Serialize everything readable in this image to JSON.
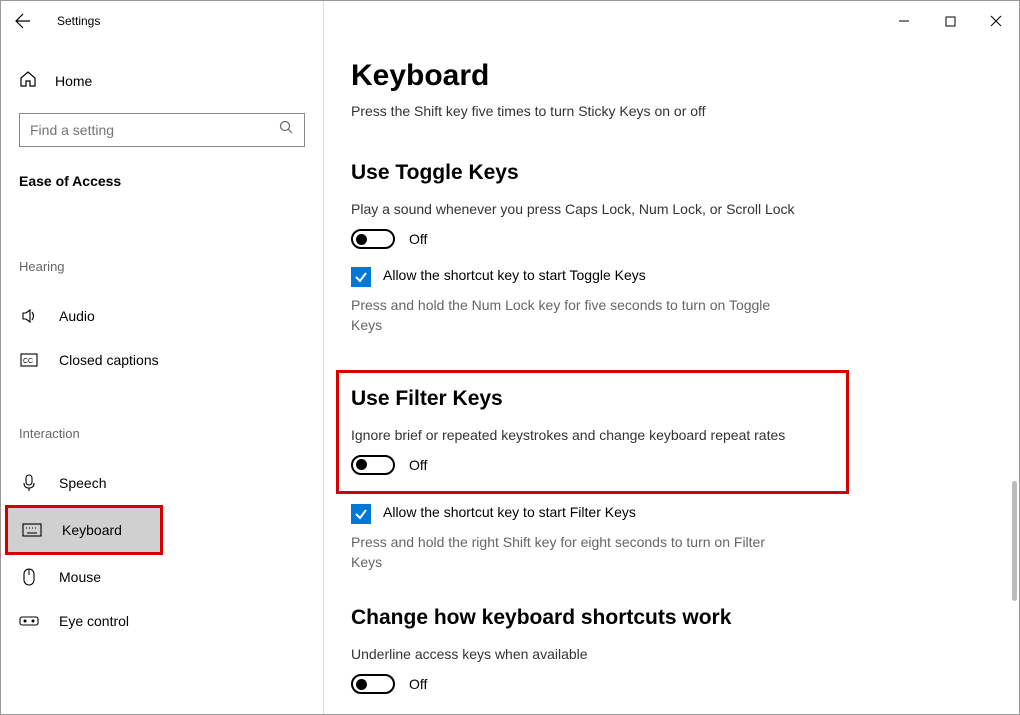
{
  "window": {
    "title": "Settings"
  },
  "sidebar": {
    "home": "Home",
    "search_placeholder": "Find a setting",
    "category": "Ease of Access",
    "groups": [
      {
        "label": "Hearing",
        "items": [
          {
            "key": "audio",
            "label": "Audio"
          },
          {
            "key": "closed-captions",
            "label": "Closed captions"
          }
        ]
      },
      {
        "label": "Interaction",
        "items": [
          {
            "key": "speech",
            "label": "Speech"
          },
          {
            "key": "keyboard",
            "label": "Keyboard"
          },
          {
            "key": "mouse",
            "label": "Mouse"
          },
          {
            "key": "eye-control",
            "label": "Eye control"
          }
        ]
      }
    ]
  },
  "main": {
    "title": "Keyboard",
    "subtitle": "Press the Shift key five times to turn Sticky Keys on or off",
    "toggleKeys": {
      "heading": "Use Toggle Keys",
      "desc": "Play a sound whenever you press Caps Lock, Num Lock, or Scroll Lock",
      "state": "Off",
      "check_label": "Allow the shortcut key to start Toggle Keys",
      "check_desc": "Press and hold the Num Lock key for five seconds to turn on Toggle Keys"
    },
    "filterKeys": {
      "heading": "Use Filter Keys",
      "desc": "Ignore brief or repeated keystrokes and change keyboard repeat rates",
      "state": "Off",
      "check_label": "Allow the shortcut key to start Filter Keys",
      "check_desc": "Press and hold the right Shift key for eight seconds to turn on Filter Keys"
    },
    "shortcuts": {
      "heading": "Change how keyboard shortcuts work",
      "desc": "Underline access keys when available",
      "state": "Off"
    }
  }
}
